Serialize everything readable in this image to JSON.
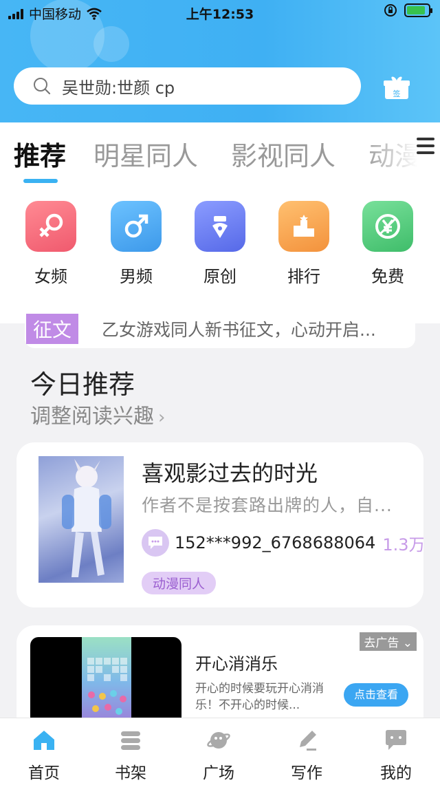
{
  "status_bar": {
    "carrier": "中国移动",
    "time": "上午12:53",
    "battery_level": 0.85
  },
  "search": {
    "placeholder": "吴世勋:世颜 cp",
    "gift_label": "签"
  },
  "tabs": [
    {
      "label": "推荐",
      "active": true
    },
    {
      "label": "明星同人",
      "active": false
    },
    {
      "label": "影视同人",
      "active": false
    },
    {
      "label": "动漫",
      "active": false
    }
  ],
  "categories": [
    {
      "label": "女频",
      "icon": "female-icon",
      "color": "#f36b7f"
    },
    {
      "label": "男频",
      "icon": "male-icon",
      "color": "#4aa9ef"
    },
    {
      "label": "原创",
      "icon": "pen-nib-icon",
      "color": "#6a7cf0"
    },
    {
      "label": "排行",
      "icon": "podium-icon",
      "color": "#f6a14e"
    },
    {
      "label": "免费",
      "icon": "yen-free-icon",
      "color": "#4fcf7c"
    }
  ],
  "notice": {
    "tag": "征文",
    "text": "乙女游戏同人新书征文，心动开启..."
  },
  "section": {
    "title": "今日推荐",
    "subtitle": "调整阅读兴趣"
  },
  "book": {
    "title": "喜观影过去的时光",
    "desc": "作者不是按套路出牌的人，自...",
    "author": "152***992_6768688064",
    "count": "1.3万",
    "genre": "动漫同人"
  },
  "ad": {
    "close_label": "去广告",
    "title": "开心消消乐",
    "desc": "开心的时候要玩开心消消乐！不开心的时候...",
    "button": "点击查看"
  },
  "bottom_nav": [
    {
      "label": "首页",
      "icon": "home-icon",
      "active": true
    },
    {
      "label": "书架",
      "icon": "bookshelf-icon",
      "active": false
    },
    {
      "label": "广场",
      "icon": "planet-icon",
      "active": false
    },
    {
      "label": "写作",
      "icon": "pencil-icon",
      "active": false
    },
    {
      "label": "我的",
      "icon": "chat-bubble-icon",
      "active": false
    }
  ],
  "colors": {
    "header": "#47b6f5",
    "accent": "#3ab2f2",
    "purple_tag": "#c08be6"
  }
}
